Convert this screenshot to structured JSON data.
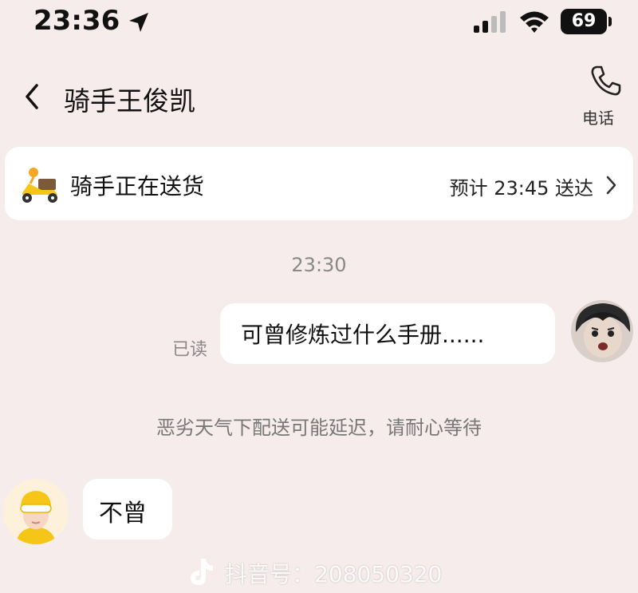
{
  "status_bar": {
    "time": "23:36",
    "battery": "69",
    "icons": [
      "location-arrow-icon",
      "signal-bars-icon",
      "wifi-icon",
      "battery-icon"
    ]
  },
  "header": {
    "title": "骑手王俊凯",
    "call_label": "电话",
    "icons": [
      "back-chevron-icon",
      "phone-icon"
    ]
  },
  "delivery": {
    "status": "骑手正在送货",
    "eta": "预计 23:45 送达",
    "icons": [
      "scooter-icon",
      "chevron-right-icon"
    ]
  },
  "chat": {
    "timestamp": "23:30",
    "outgoing": {
      "text": "可曾修炼过什么手册......",
      "read_status": "已读"
    },
    "system_notice": "恶劣天气下配送可能延迟，请耐心等待",
    "incoming": {
      "text": "不曾"
    }
  },
  "watermark": {
    "text": "抖音号：208050320"
  },
  "colors": {
    "background": "#f7ecec",
    "card": "#ffffff",
    "accent_yellow": "#f5c518",
    "muted_text": "#888888"
  }
}
